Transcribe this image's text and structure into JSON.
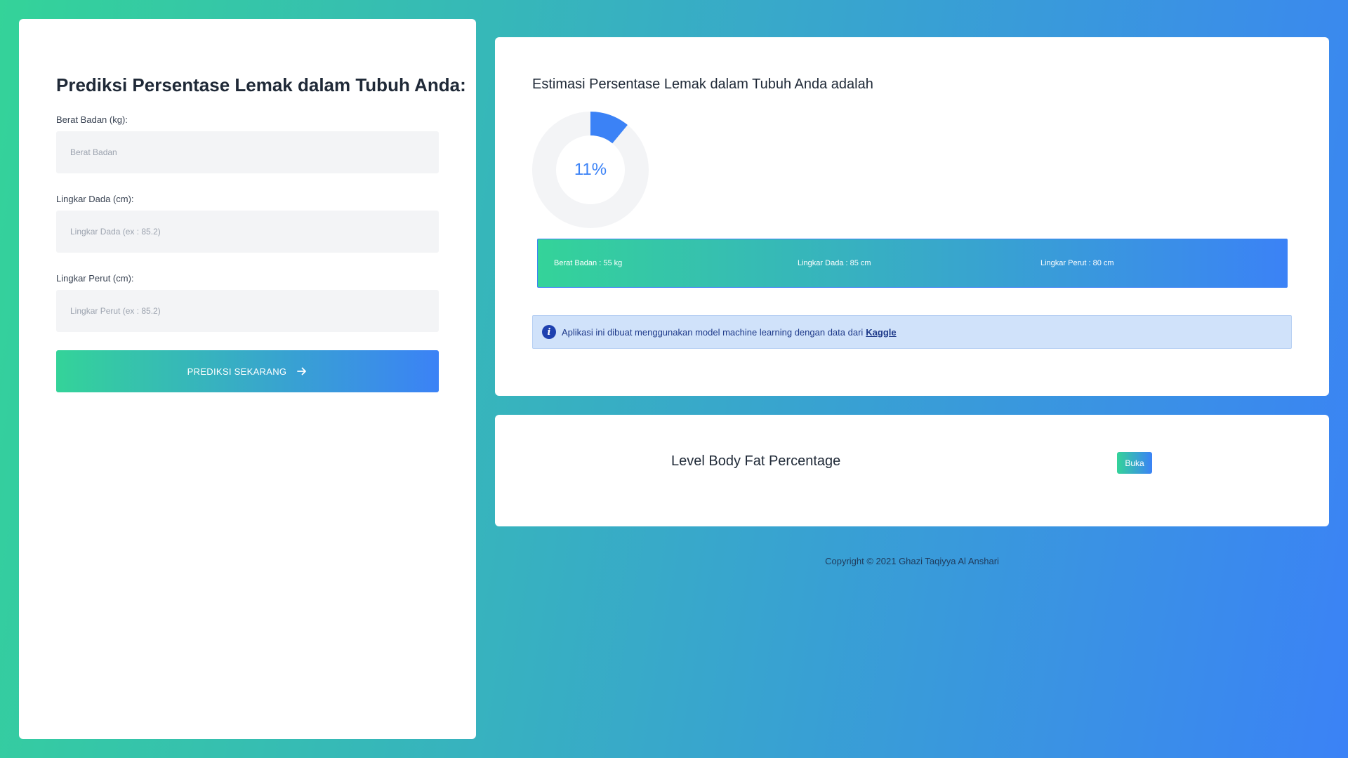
{
  "form": {
    "title": "Prediksi Persentase Lemak dalam Tubuh Anda:",
    "fields": [
      {
        "label": "Berat Badan (kg):",
        "placeholder": "Berat Badan",
        "value": ""
      },
      {
        "label": "Lingkar Dada (cm):",
        "placeholder": "Lingkar Dada (ex : 85.2)",
        "value": ""
      },
      {
        "label": "Lingkar Perut (cm):",
        "placeholder": "Lingkar Perut (ex : 85.2)",
        "value": ""
      }
    ],
    "submit_label": "PREDIKSI SEKARANG",
    "submit_icon": "arrow-right-icon"
  },
  "result": {
    "title": "Estimasi Persentase Lemak dalam Tubuh Anda adalah",
    "percent_value": 11,
    "percent_text": "11%",
    "stats": [
      {
        "text": "Berat Badan : 55 kg"
      },
      {
        "text": "Lingkar Dada : 85 cm"
      },
      {
        "text": "Lingkar Perut : 80 cm"
      }
    ],
    "info": {
      "icon": "info-icon",
      "icon_glyph": "i",
      "text": "Aplikasi ini dibuat menggunakan model machine learning dengan data dari",
      "link_text": "Kaggle"
    }
  },
  "level": {
    "title": "Level Body Fat Percentage",
    "button_label": "Buka"
  },
  "footer": {
    "copyright": "Copyright © 2021 Ghazi Taqiyya Al Anshari"
  },
  "colors": {
    "gradient_start": "#34d399",
    "gradient_end": "#3b82f6",
    "accent": "#3b82f6",
    "donut_track": "#f3f4f6",
    "info_bg": "#d0e2fa",
    "info_text": "#1e3a8a"
  }
}
